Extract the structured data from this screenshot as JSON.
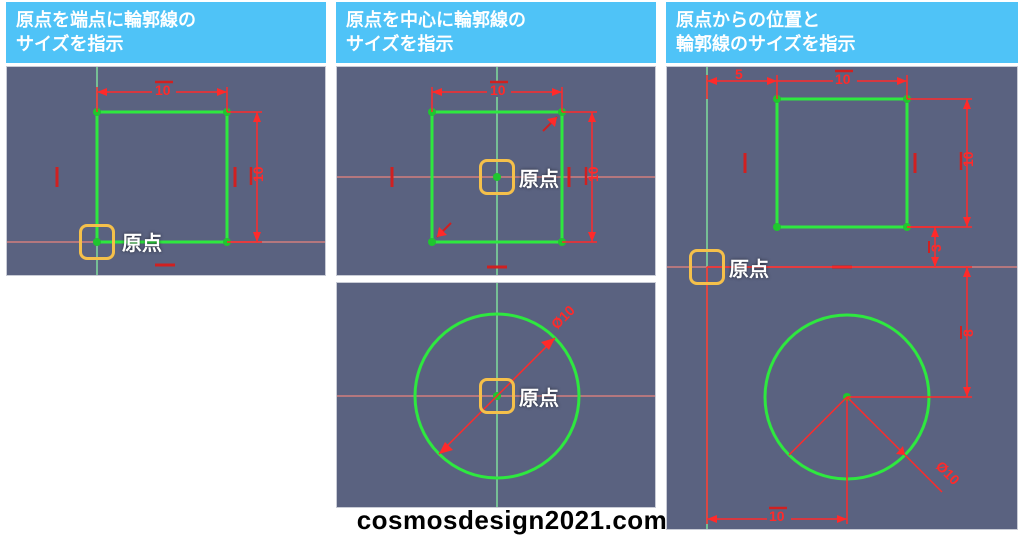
{
  "headers": {
    "left": "原点を端点に輪郭線の\nサイズを指示",
    "center": "原点を中心に輪郭線の\nサイズを指示",
    "right": "原点からの位置と\n輪郭線のサイズを指示"
  },
  "origin_label": "原点",
  "dims": {
    "ten": "10",
    "five": "5",
    "three": "3",
    "eight": "8",
    "diameter10": "Ø10"
  },
  "watermark": "cosmosdesign2021.com"
}
